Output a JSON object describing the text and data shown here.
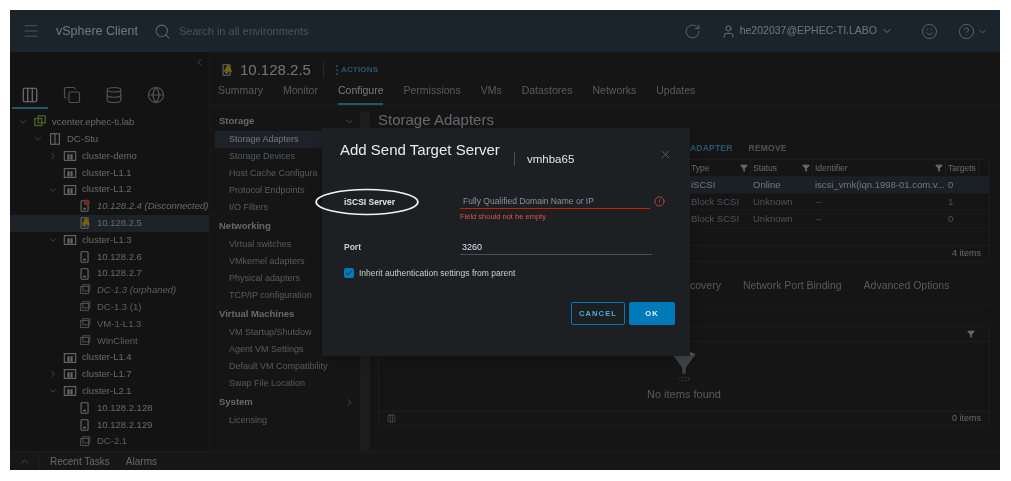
{
  "top_bar": {
    "app_name": "vSphere Client",
    "search": {
      "placeholder": "Search in all environments"
    },
    "user": "he202037@EPHEC-TI.LABO"
  },
  "navigator": {
    "view_tabs": [
      {
        "kind": "hosts",
        "selected": true
      },
      {
        "kind": "vms",
        "selected": false
      },
      {
        "kind": "storage",
        "selected": false
      },
      {
        "kind": "network",
        "selected": false
      }
    ],
    "tree": [
      {
        "label": "vcenter.ephec-ti.lab",
        "kind": "vcenter",
        "expanded": true,
        "selected": false,
        "children": [
          {
            "label": "DC-Stu",
            "kind": "datacenter",
            "expanded": true,
            "selected": false,
            "children": [
              {
                "label": "cluster-demo",
                "kind": "cluster",
                "expanded": false,
                "selected": false
              },
              {
                "label": "cluster-L1.1",
                "kind": "cluster",
                "selected": false
              },
              {
                "label": "cluster-L1.2",
                "kind": "cluster",
                "expanded": true,
                "selected": false,
                "children": [
                  {
                    "label": "10.128.2.4 (Disconnected)",
                    "kind": "host",
                    "error": true,
                    "warning": false,
                    "inaccessible": true,
                    "selected": false
                  },
                  {
                    "label": "10.128.2.5",
                    "kind": "host",
                    "error": false,
                    "warning": true,
                    "selected": true
                  }
                ]
              },
              {
                "label": "cluster-L1.3",
                "kind": "cluster",
                "expanded": true,
                "selected": false,
                "children": [
                  {
                    "label": "10.128.2.6",
                    "kind": "host",
                    "error": false,
                    "warning": false,
                    "selected": false
                  },
                  {
                    "label": "10.128.2.7",
                    "kind": "host",
                    "error": false,
                    "warning": false,
                    "selected": false
                  },
                  {
                    "label": "DC-1.3 (orphaned)",
                    "kind": "vm",
                    "inaccessible": true,
                    "selected": false
                  },
                  {
                    "label": "DC-1.3 (1)",
                    "kind": "vm",
                    "selected": false
                  },
                  {
                    "label": "VM-1-L1.3",
                    "kind": "vm",
                    "selected": false
                  },
                  {
                    "label": "WinClient",
                    "kind": "vm",
                    "selected": false
                  }
                ]
              },
              {
                "label": "cluster-L1.4",
                "kind": "cluster",
                "selected": false
              },
              {
                "label": "cluster-L1.7",
                "kind": "cluster",
                "expanded": false,
                "selected": false
              },
              {
                "label": "cluster-L2.1",
                "kind": "cluster",
                "expanded": true,
                "selected": false,
                "children": [
                  {
                    "label": "10.128.2.128",
                    "kind": "host",
                    "error": false,
                    "warning": false,
                    "selected": false
                  },
                  {
                    "label": "10.128.2.129",
                    "kind": "host",
                    "error": false,
                    "warning": false,
                    "selected": false
                  },
                  {
                    "label": "DC-2.1",
                    "kind": "vm",
                    "selected": false
                  }
                ]
              }
            ]
          }
        ]
      }
    ]
  },
  "object_header": {
    "title": "10.128.2.5",
    "warning": true,
    "actions": "ACTIONS"
  },
  "tabs": [
    {
      "label": "Summary",
      "selected": false
    },
    {
      "label": "Monitor",
      "selected": false
    },
    {
      "label": "Configure",
      "selected": true
    },
    {
      "label": "Permissions",
      "selected": false
    },
    {
      "label": "VMs",
      "selected": false
    },
    {
      "label": "Datastores",
      "selected": false
    },
    {
      "label": "Networks",
      "selected": false
    },
    {
      "label": "Updates",
      "selected": false
    }
  ],
  "configure_nav": [
    {
      "title": "Storage",
      "expanded": true,
      "items": [
        {
          "label": "Storage Adapters",
          "selected": true
        },
        {
          "label": "Storage Devices",
          "selected": false
        },
        {
          "label": "Host Cache Configura",
          "selected": false
        },
        {
          "label": "Protocol Endpoints",
          "selected": false
        },
        {
          "label": "I/O Filters",
          "selected": false
        }
      ]
    },
    {
      "title": "Networking",
      "items": [
        {
          "label": "Virtual switches",
          "selected": false
        },
        {
          "label": "VMkernel adapters",
          "selected": false
        },
        {
          "label": "Physical adapters",
          "selected": false
        },
        {
          "label": "TCP/IP configuration",
          "selected": false
        }
      ]
    },
    {
      "title": "Virtual Machines",
      "items": [
        {
          "label": "VM Startup/Shutdow",
          "selected": false
        },
        {
          "label": "Agent VM Settings",
          "selected": false
        },
        {
          "label": "Default VM Compatibility",
          "selected": false
        },
        {
          "label": "Swap File Location",
          "selected": false
        }
      ]
    },
    {
      "title": "System",
      "expanded": false,
      "items": [
        {
          "label": "Licensing",
          "selected": false
        }
      ]
    }
  ],
  "main": {
    "title": "Storage Adapters",
    "toolbar": [
      {
        "label": "ADAPTER",
        "disabled": false
      },
      {
        "label": "REMOVE",
        "disabled": true
      }
    ],
    "adapters_table": {
      "columns": [
        "Type",
        "Status",
        "Identifier",
        "Targets"
      ],
      "rows": [
        {
          "cells": [
            "iSCSI",
            "Online",
            "iscsi_vmk(iqn.1998-01.com.v...",
            "0"
          ],
          "selected": true
        },
        {
          "cells": [
            "Block SCSI",
            "Unknown",
            "--",
            "1"
          ],
          "selected": false
        },
        {
          "cells": [
            "Block SCSI",
            "Unknown",
            "--",
            "0"
          ],
          "selected": false
        }
      ],
      "footer": "4 items"
    },
    "detail_tabs": [
      {
        "label": "covery",
        "selected": false
      },
      {
        "label": "Network Port Binding",
        "selected": false
      },
      {
        "label": "Advanced Options",
        "selected": false
      }
    ],
    "detail_table": {
      "empty_text": "No items found",
      "footer": "0 items"
    }
  },
  "bottom_bar": {
    "tabs": [
      "Recent Tasks",
      "Alarms"
    ]
  },
  "dialog": {
    "title": "Add Send Target Server",
    "subtitle": "vmhba65",
    "server_field": {
      "label": "iSCSI Server",
      "placeholder": "Fully Qualified Domain Name or IP",
      "error": "Field should not be empty",
      "annotated": true
    },
    "port_field": {
      "label": "Port",
      "value": "3260"
    },
    "inherit_checkbox": {
      "label": "Inherit authentication settings from parent",
      "checked": true
    },
    "buttons": [
      {
        "label": "CANCEL",
        "kind": "secondary"
      },
      {
        "label": "OK",
        "kind": "primary"
      }
    ]
  }
}
